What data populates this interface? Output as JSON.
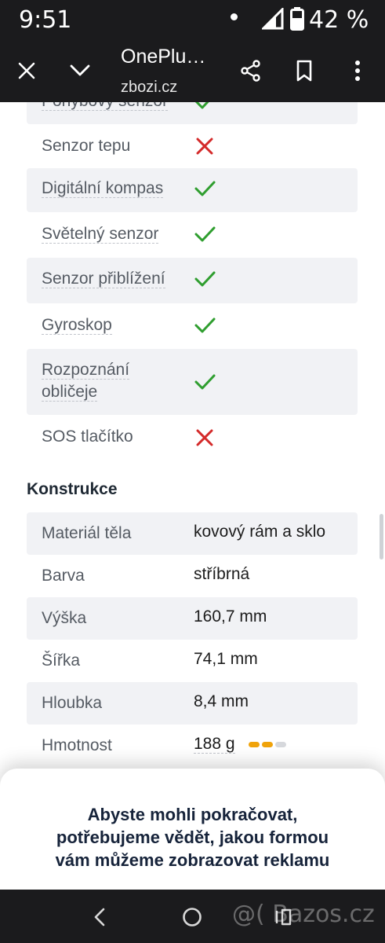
{
  "status_bar": {
    "time": "9:51",
    "battery_percent": "42 %",
    "icons": [
      "notification-dot-icon",
      "signal-icon",
      "battery-icon"
    ]
  },
  "toolbar": {
    "title": "OnePlu…",
    "url": "zbozi.cz",
    "icons": [
      "close-icon",
      "chevron-down-icon",
      "share-icon",
      "bookmark-icon",
      "more-vert-icon"
    ]
  },
  "sensors": [
    {
      "label": "Pohybový senzor",
      "available": true
    },
    {
      "label": "Senzor tepu",
      "available": false
    },
    {
      "label": "Digitální kompas",
      "available": true
    },
    {
      "label": "Světelný senzor",
      "available": true
    },
    {
      "label": "Senzor přiblížení",
      "available": true
    },
    {
      "label": "Gyroskop",
      "available": true
    },
    {
      "label": "Rozpoznání obličeje",
      "label_line1": "Rozpoznání",
      "label_line2": "obličeje",
      "available": true
    },
    {
      "label": "SOS tlačítko",
      "available": false
    }
  ],
  "construction": {
    "title": "Konstrukce",
    "rows": [
      {
        "label": "Materiál těla",
        "value": "kovový rám a sklo"
      },
      {
        "label": "Barva",
        "value": "stříbrná"
      },
      {
        "label": "Výška",
        "value": "160,7 mm"
      },
      {
        "label": "Šířka",
        "value": "74,1 mm"
      },
      {
        "label": "Hloubka",
        "value": "8,4 mm"
      },
      {
        "label": "Hmotnost",
        "value": "188 g",
        "rating_filled": 2,
        "rating_total": 3
      }
    ]
  },
  "dialog": {
    "line1": "Abyste mohli pokračovat,",
    "line2": "potřebujeme vědět, jakou formou",
    "line3": "vám můžeme zobrazovat reklamu"
  },
  "nav_bar": {
    "icons": [
      "back-icon",
      "home-icon",
      "recents-icon"
    ],
    "watermark": "@( Bazos.cz"
  },
  "colors": {
    "check": "#2f9e2f",
    "cross": "#d42a2a",
    "rating_filled": "#f0a30a",
    "rating_empty": "#d6d8dc",
    "system_bar": "#1b1b1d",
    "row_shade": "#f1f2f5"
  }
}
